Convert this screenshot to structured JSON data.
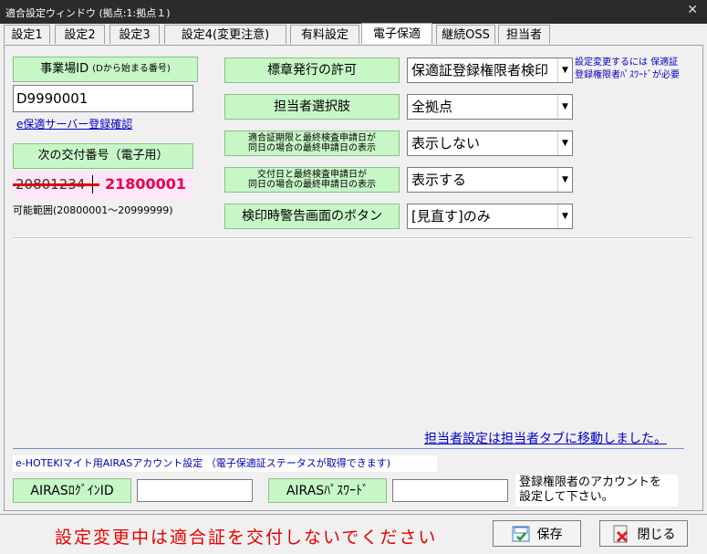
{
  "window": {
    "title": "適合設定ウィンドウ (拠点:1:拠点１)",
    "close_glyph": "✕"
  },
  "tabs": [
    {
      "label": "設定1"
    },
    {
      "label": "設定2"
    },
    {
      "label": "設定3"
    },
    {
      "label": "設定4(変更注意)"
    },
    {
      "label": "有料設定"
    },
    {
      "label": "電子保適"
    },
    {
      "label": "継続OSS"
    },
    {
      "label": "担当者"
    }
  ],
  "left": {
    "office_id_label": "事業場ID",
    "office_id_hint": "(Dから始まる番号)",
    "office_id_value": "D9990001",
    "server_link": "e保適サーバー登録確認",
    "next_number_label": "次の交付番号（電子用）",
    "next_number_old": "20801234",
    "next_number_new": "21800001",
    "range_text": "可能範囲(20800001～20999999)"
  },
  "settings": [
    {
      "label": "標章発行の許可",
      "value": "保適証登録権限者検印"
    },
    {
      "label": "担当者選択肢",
      "value": "全拠点"
    },
    {
      "label_line1": "適合証期限と最終検査申請日が",
      "label_line2": "同日の場合の最終申請日の表示",
      "value": "表示しない"
    },
    {
      "label_line1": "交付日と最終検査申請日が",
      "label_line2": "同日の場合の最終申請日の表示",
      "value": "表示する"
    },
    {
      "label": "検印時警告画面のボタン",
      "value": "[見直す]のみ"
    }
  ],
  "note": {
    "line1": "設定変更するには 保適証",
    "line2": "登録権限者ﾊﾟｽﾜｰﾄﾞが必要"
  },
  "staff_link": "担当者設定は担当者タブに移動しました。",
  "airas": {
    "section_title": "e-HOTEKIマイト用AIRASアカウント設定 （電子保適証ステータスが取得できます)",
    "login_label": "AIRASﾛｸﾞｲﾝID",
    "login_value": "",
    "password_label": "AIRASﾊﾟｽﾜｰﾄﾞ",
    "password_value": "",
    "note_line1": "登録権限者のアカウントを",
    "note_line2": "設定して下さい。"
  },
  "footer": {
    "warning": "設定変更中は適合証を交付しないでください",
    "save_label": "保存",
    "close_label": "閉じる"
  },
  "colors": {
    "accent_green": "#c7f7c7",
    "warning_red": "#e60000",
    "link_blue": "#0000c0"
  }
}
